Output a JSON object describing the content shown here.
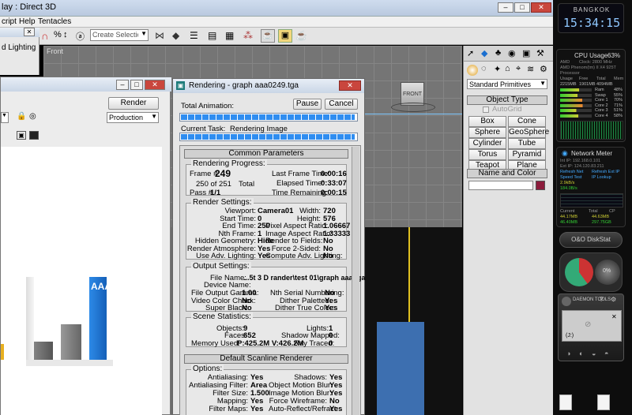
{
  "app": {
    "title_fragment": "lay : Direct 3D",
    "menu": [
      "cript",
      "Help",
      "Tentacles"
    ],
    "selection_set_placeholder": "Create Selection Set",
    "viewport_label": "Front",
    "viewcube_label": "FRONT"
  },
  "left_panel": {
    "partial_item": "d Lighting"
  },
  "render_setup": {
    "render_label": "Render",
    "preset": "Production"
  },
  "chart_preview": {
    "bar_label": "AAA"
  },
  "rendering": {
    "title": "Rendering - graph aaa0249.tga",
    "total_animation_label": "Total Animation:",
    "pause_label": "Pause",
    "cancel_label": "Cancel",
    "current_task_label": "Current Task:",
    "current_task_value": "Rendering Image",
    "total_progress": 0.99,
    "task_progress": 0.99,
    "common_params_title": "Common Parameters",
    "progress": {
      "group_title": "Rendering Progress:",
      "frame_label": "Frame #",
      "frame_value": "249",
      "count_value": "250 of 251",
      "total_label": "Total",
      "pass_label": "Pass #",
      "pass_value": "1/1",
      "last_frame_label": "Last Frame Time:",
      "last_frame_value": "0:00:16",
      "elapsed_label": "Elapsed Time:",
      "elapsed_value": "0:33:07",
      "remaining_label": "Time Remaining:",
      "remaining_value": "0:00:15"
    },
    "settings": {
      "group_title": "Render Settings:",
      "left": [
        {
          "label": "Viewport:",
          "value": "Camera01"
        },
        {
          "label": "Start Time:",
          "value": "0"
        },
        {
          "label": "End Time:",
          "value": "250"
        },
        {
          "label": "Nth Frame:",
          "value": "1"
        },
        {
          "label": "Hidden Geometry:",
          "value": "Hide"
        },
        {
          "label": "Render Atmosphere:",
          "value": "Yes"
        },
        {
          "label": "Use Adv. Lighting:",
          "value": "Yes"
        }
      ],
      "right": [
        {
          "label": "Width:",
          "value": "720"
        },
        {
          "label": "Height:",
          "value": "576"
        },
        {
          "label": "Pixel Aspect Ratio:",
          "value": "1.06667"
        },
        {
          "label": "Image Aspect Ratio:",
          "value": "1.33333"
        },
        {
          "label": "Render to Fields:",
          "value": "No"
        },
        {
          "label": "Force 2-Sided:",
          "value": "No"
        },
        {
          "label": "Compute Adv. Lighting:",
          "value": "No"
        }
      ]
    },
    "output": {
      "group_title": "Output Settings:",
      "file_name_label": "File Name:",
      "file_name_value": "...5t 3 D rander\\test 01\\graph aaa.tga",
      "device_name_label": "Device Name:",
      "left": [
        {
          "label": "File Output Gamma:",
          "value": "1.00"
        },
        {
          "label": "Video Color Check:",
          "value": "No"
        },
        {
          "label": "Super Black:",
          "value": "No"
        }
      ],
      "right": [
        {
          "label": "Nth Serial Numbering:",
          "value": "No"
        },
        {
          "label": "Dither Paletted:",
          "value": "Yes"
        },
        {
          "label": "Dither True Color:",
          "value": "Yes"
        }
      ]
    },
    "stats": {
      "group_title": "Scene Statistics:",
      "left": [
        {
          "label": "Objects:",
          "value": "9"
        },
        {
          "label": "Faces:",
          "value": "652"
        },
        {
          "label": "Memory Used:",
          "value": "P:425.2M V:426.2M"
        }
      ],
      "right": [
        {
          "label": "Lights:",
          "value": "1"
        },
        {
          "label": "Shadow Mapped:",
          "value": "0"
        },
        {
          "label": "Ray Traced:",
          "value": "0"
        }
      ]
    },
    "scanline_title": "Default Scanline Renderer",
    "options": {
      "group_title": "Options:",
      "left": [
        {
          "label": "Antialiasing:",
          "value": "Yes"
        },
        {
          "label": "Antialiasing Filter:",
          "value": "Area"
        },
        {
          "label": "Filter Size:",
          "value": "1.500"
        },
        {
          "label": "Mapping:",
          "value": "Yes"
        },
        {
          "label": "Filter Maps:",
          "value": "Yes"
        }
      ],
      "right": [
        {
          "label": "Shadows:",
          "value": "Yes"
        },
        {
          "label": "Object Motion Blur:",
          "value": "Yes"
        },
        {
          "label": "Image Motion Blur:",
          "value": "Yes"
        },
        {
          "label": "Force Wireframe:",
          "value": "No"
        },
        {
          "label": "Auto-Reflect/Refract:",
          "value": "Yes"
        }
      ]
    }
  },
  "command_panel": {
    "dropdown": "Standard Primitives",
    "object_type_title": "Object Type",
    "autogrid_label": "AutoGrid",
    "buttons": [
      "Box",
      "Cone",
      "Sphere",
      "GeoSphere",
      "Cylinder",
      "Tube",
      "Torus",
      "Pyramid",
      "Teapot",
      "Plane"
    ],
    "name_color_title": "Name and Color"
  },
  "gadgets": {
    "city": "BANGKOK",
    "time": "15:34:15",
    "cpu_title": "CPU Usage",
    "cpu_pct": "63%",
    "cpu_lines": [
      "AMD",
      "Clock: 2800 MHz",
      "AMD Phenom(tm) II X4 925T",
      "Processor"
    ],
    "cpu_cols": [
      "Usage",
      "Free",
      "Total",
      "Mem"
    ],
    "cpu_vals": [
      "2215MB",
      "1901MB",
      "4094MB"
    ],
    "cores": [
      {
        "name": "Ram",
        "pct": "48%"
      },
      {
        "name": "Swap",
        "pct": "55%"
      },
      {
        "name": "Core 1",
        "pct": "70%"
      },
      {
        "name": "Core 2",
        "pct": "71%"
      },
      {
        "name": "Core 3",
        "pct": "51%"
      },
      {
        "name": "Core 4",
        "pct": "58%"
      }
    ],
    "net_title": "Network Meter",
    "net_lines": [
      "Int IP: 192.168.0.101",
      "Ext IP: 124.120.83.211",
      "Refresh Net",
      "Refresh Ext IP",
      "Speed Test",
      "IP Lookup"
    ],
    "net_rates": [
      "2.9kB/s",
      "184.0B/s"
    ],
    "net_cols": [
      "Current",
      "Total",
      "CP"
    ],
    "net_vals": [
      "44.17MB",
      "44.63MB",
      "46.40MB",
      "297.75GB"
    ],
    "disk_title": "O&O DiskStat",
    "daemon_title": "DAEMON TOOLS",
    "daemon_drive": "(J:)",
    "gauge_pct": "0%"
  },
  "colors": {
    "accent_blue": "#1f7fe0",
    "swatch": "#8c1c3c",
    "timer_bg": "#0a0a12"
  }
}
